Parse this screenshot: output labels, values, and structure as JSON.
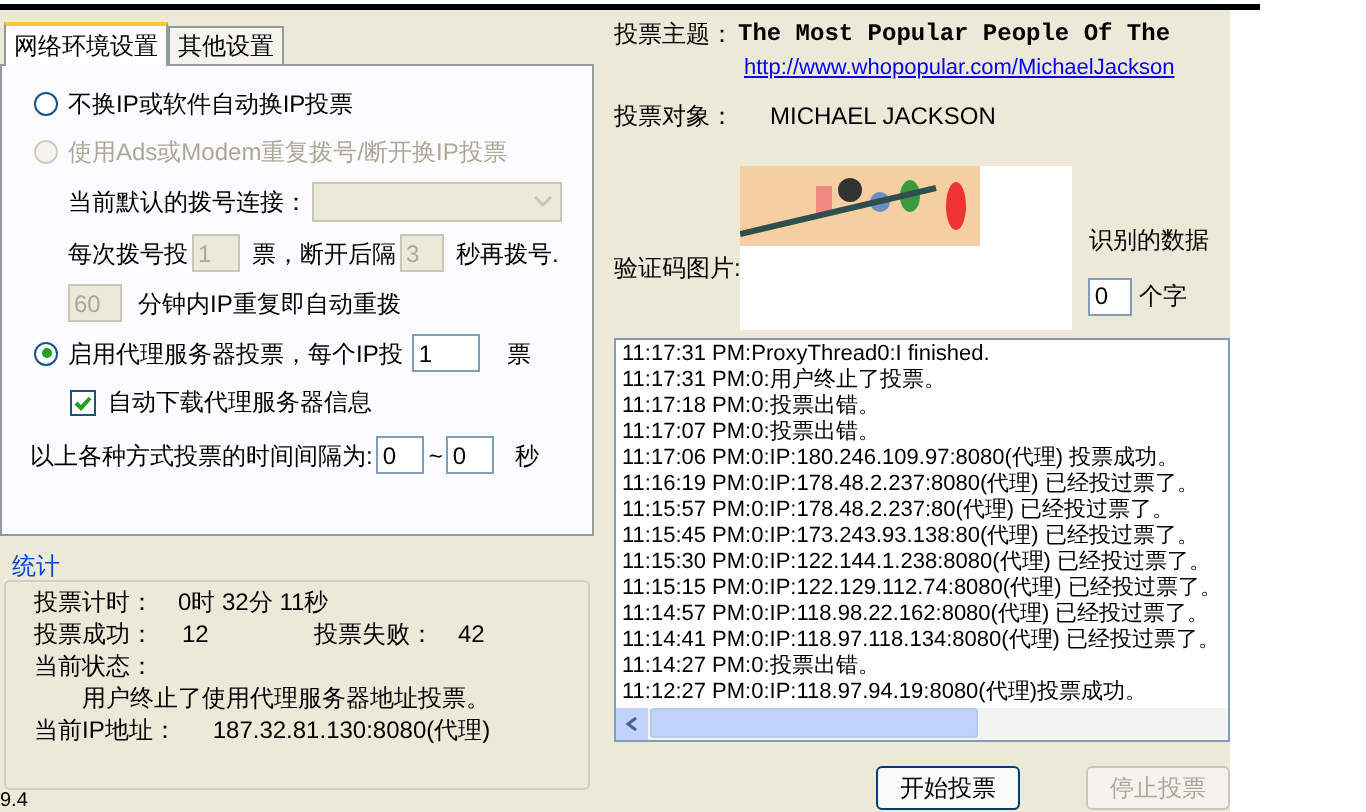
{
  "tabs": [
    {
      "label": "网络环境设置",
      "selected": true
    },
    {
      "label": "其他设置",
      "selected": false
    }
  ],
  "no_ip_change": {
    "label": "不换IP或软件自动换IP投票",
    "selected": false
  },
  "dialup": {
    "label": "使用Ads或Modem重复拨号/断开换IP投票",
    "selected": false,
    "disabled": true,
    "connection_label": "当前默认的拨号连接：",
    "votes_prefix": "每次拨号投",
    "votes_value": "1",
    "votes_mid": "票，断开后隔",
    "wait_value": "3",
    "wait_suffix": "秒再拨号.",
    "repeat_value": "60",
    "repeat_suffix": "分钟内IP重复即自动重拨"
  },
  "proxy": {
    "label": "启用代理服务器投票，每个IP投",
    "selected": true,
    "value": "1",
    "suffix": "票",
    "auto_download": {
      "label": "自动下载代理服务器信息",
      "checked": true
    }
  },
  "interval": {
    "label": "以上各种方式投票的时间间隔为:",
    "from": "0",
    "sep": "~",
    "to": "0",
    "unit": "秒"
  },
  "stats": {
    "title": "统计",
    "timer_label": "投票计时：",
    "timer": "0时 32分 11秒",
    "success_label": "投票成功：",
    "success": "12",
    "fail_label": "投票失败：",
    "fail": "42",
    "status_label": "当前状态：",
    "status": "用户终止了使用代理服务器地址投票。",
    "ip_label": "当前IP地址：",
    "ip": "187.32.81.130:8080(代理)"
  },
  "version": "9.4",
  "subject": {
    "label": "投票主题：",
    "title": "The Most Popular People Of The",
    "link": "http://www.whopopular.com/MichaelJackson"
  },
  "target": {
    "label": "投票对象：",
    "value": "MICHAEL JACKSON"
  },
  "captcha": {
    "label": "验证码图片:",
    "recognized_label": "识别的数据",
    "count": "0",
    "count_suffix": "个字"
  },
  "log": [
    "11:17:31 PM:ProxyThread0:I finished.",
    "11:17:31 PM:0:用户终止了投票。",
    "11:17:18 PM:0:投票出错。",
    "11:17:07 PM:0:投票出错。",
    "11:17:06 PM:0:IP:180.246.109.97:8080(代理) 投票成功。",
    "11:16:19 PM:0:IP:178.48.2.237:8080(代理) 已经投过票了。",
    "11:15:57 PM:0:IP:178.48.2.237:80(代理) 已经投过票了。",
    "11:15:45 PM:0:IP:173.243.93.138:80(代理) 已经投过票了。",
    "11:15:30 PM:0:IP:122.144.1.238:8080(代理) 已经投过票了。",
    "11:15:15 PM:0:IP:122.129.112.74:8080(代理) 已经投过票了。",
    "11:14:57 PM:0:IP:118.98.22.162:8080(代理) 已经投过票了。",
    "11:14:41 PM:0:IP:118.97.118.134:8080(代理) 已经投过票了。",
    "11:14:27 PM:0:投票出错。",
    "11:12:27 PM:0:IP:118.97.94.19:8080(代理)投票成功。"
  ],
  "buttons": [
    {
      "label": "开始投票",
      "disabled": false
    },
    {
      "label": "停止投票",
      "disabled": true
    }
  ]
}
